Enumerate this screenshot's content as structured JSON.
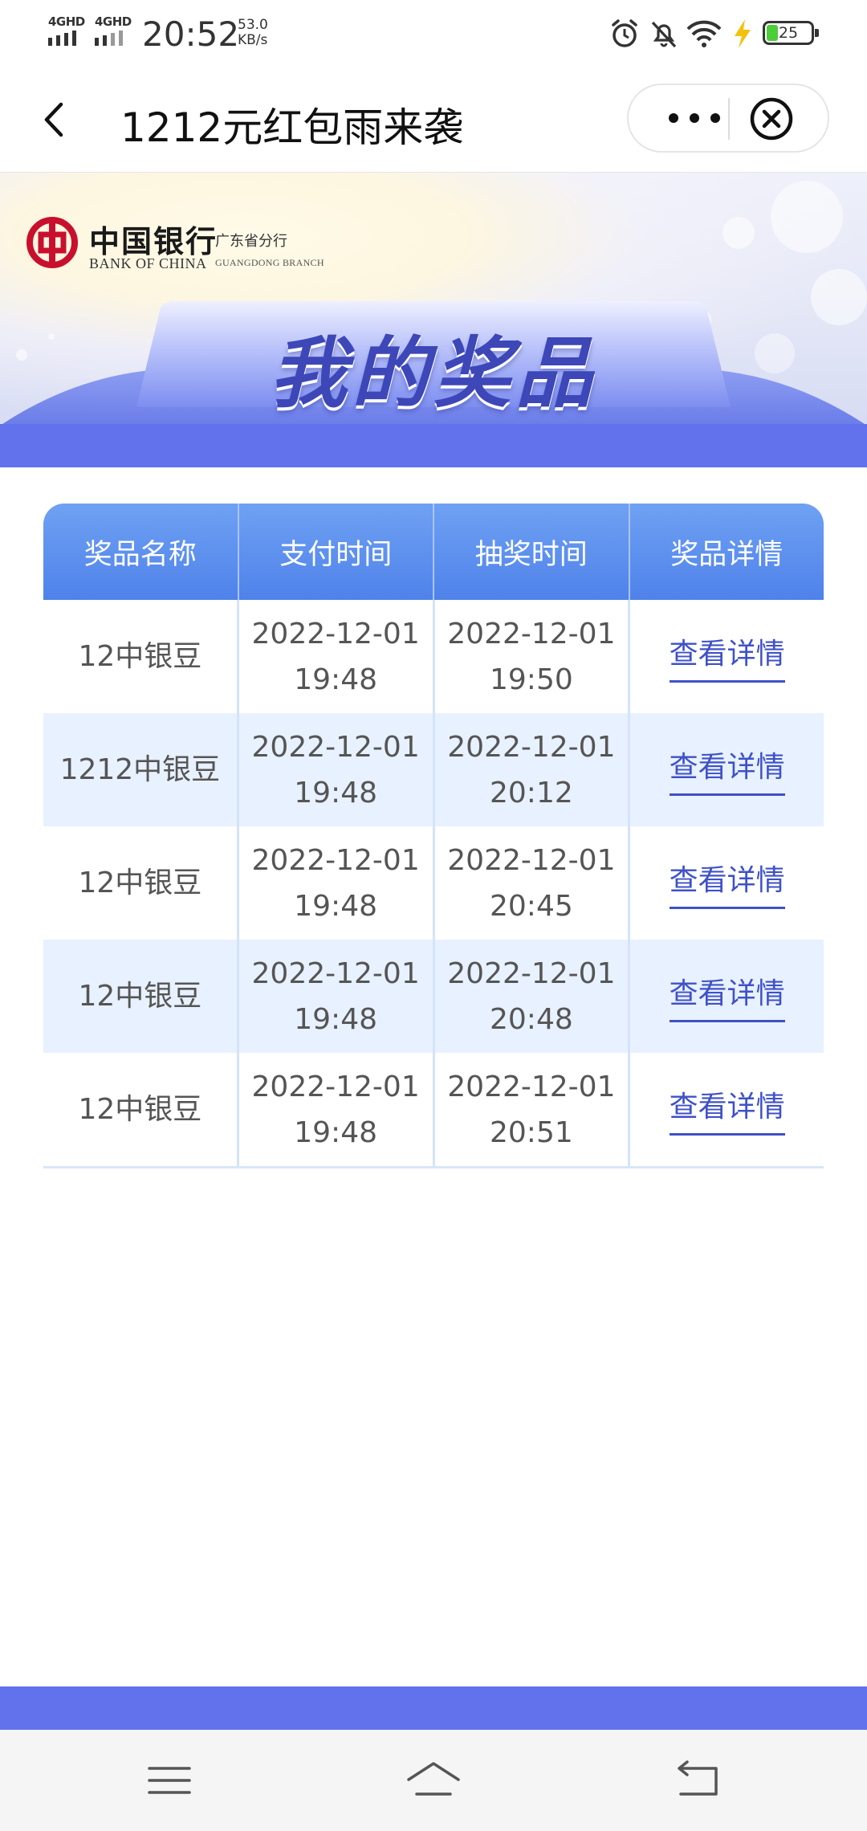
{
  "status_bar": {
    "net1": "4GHD",
    "net2": "4GHD",
    "time": "20:52",
    "speed_value": "53.0",
    "speed_unit": "KB/s",
    "battery": "25"
  },
  "nav": {
    "title": "1212元红包雨来袭"
  },
  "banner": {
    "bank_cn": "中国银行",
    "bank_en": "BANK OF CHINA",
    "branch_cn": "广东省分行",
    "branch_en": "GUANGDONG BRANCH",
    "title": "我的奖品"
  },
  "table": {
    "headers": [
      "奖品名称",
      "支付时间",
      "抽奖时间",
      "奖品详情"
    ],
    "rows": [
      {
        "name": "12中银豆",
        "pay_date": "2022-12-01",
        "pay_time": "19:48",
        "draw_date": "2022-12-01",
        "draw_time": "19:50",
        "link": "查看详情"
      },
      {
        "name": "1212中银豆",
        "pay_date": "2022-12-01",
        "pay_time": "19:48",
        "draw_date": "2022-12-01",
        "draw_time": "20:12",
        "link": "查看详情"
      },
      {
        "name": "12中银豆",
        "pay_date": "2022-12-01",
        "pay_time": "19:48",
        "draw_date": "2022-12-01",
        "draw_time": "20:45",
        "link": "查看详情"
      },
      {
        "name": "12中银豆",
        "pay_date": "2022-12-01",
        "pay_time": "19:48",
        "draw_date": "2022-12-01",
        "draw_time": "20:48",
        "link": "查看详情"
      },
      {
        "name": "12中银豆",
        "pay_date": "2022-12-01",
        "pay_time": "19:48",
        "draw_date": "2022-12-01",
        "draw_time": "20:51",
        "link": "查看详情"
      }
    ]
  },
  "colors": {
    "accent": "#6272ec",
    "header_blue": "#4f82ea",
    "link": "#3f51c8",
    "row_alt": "#e8f1ff"
  },
  "icons": {
    "back": "chevron-left-icon",
    "more": "more-dots-icon",
    "close": "close-circle-icon",
    "menu": "menu-icon",
    "home": "home-icon",
    "return": "back-arrow-icon"
  }
}
